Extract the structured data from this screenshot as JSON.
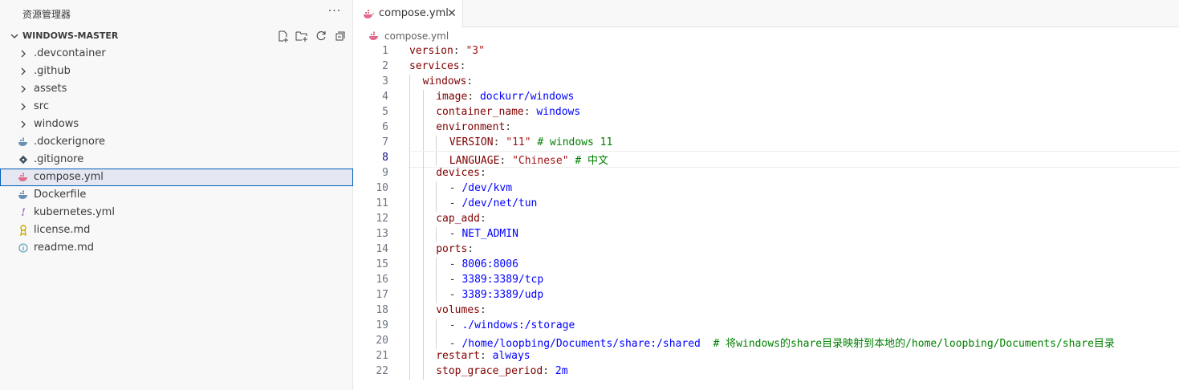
{
  "explorer": {
    "title": "资源管理器",
    "more_label": "···",
    "folder_name": "WINDOWS-MASTER",
    "items": [
      {
        "label": ".devcontainer",
        "kind": "folder",
        "icon": "chevron-right-icon"
      },
      {
        "label": ".github",
        "kind": "folder",
        "icon": "chevron-right-icon"
      },
      {
        "label": "assets",
        "kind": "folder",
        "icon": "chevron-right-icon"
      },
      {
        "label": "src",
        "kind": "folder",
        "icon": "chevron-right-icon"
      },
      {
        "label": "windows",
        "kind": "folder",
        "icon": "chevron-right-icon"
      },
      {
        "label": ".dockerignore",
        "kind": "file",
        "icon": "docker-icon"
      },
      {
        "label": ".gitignore",
        "kind": "file",
        "icon": "git-icon"
      },
      {
        "label": "compose.yml",
        "kind": "file",
        "icon": "docker-compose-icon",
        "selected": true
      },
      {
        "label": "Dockerfile",
        "kind": "file",
        "icon": "docker-icon"
      },
      {
        "label": "kubernetes.yml",
        "kind": "file",
        "icon": "yaml-icon"
      },
      {
        "label": "license.md",
        "kind": "file",
        "icon": "license-icon"
      },
      {
        "label": "readme.md",
        "kind": "file",
        "icon": "info-icon"
      }
    ]
  },
  "editor": {
    "tab_label": "compose.yml",
    "breadcrumb": "compose.yml",
    "current_line": 8,
    "lines": [
      {
        "n": "1",
        "indent": 0,
        "parts": [
          [
            "k",
            "version"
          ],
          [
            "p",
            ": "
          ],
          [
            "s",
            "\"3\""
          ]
        ]
      },
      {
        "n": "2",
        "indent": 0,
        "parts": [
          [
            "k",
            "services"
          ],
          [
            "p",
            ":"
          ]
        ]
      },
      {
        "n": "3",
        "indent": 1,
        "parts": [
          [
            "k",
            "windows"
          ],
          [
            "p",
            ":"
          ]
        ]
      },
      {
        "n": "4",
        "indent": 2,
        "parts": [
          [
            "k",
            "image"
          ],
          [
            "p",
            ": "
          ],
          [
            "v",
            "dockurr/windows"
          ]
        ]
      },
      {
        "n": "5",
        "indent": 2,
        "parts": [
          [
            "k",
            "container_name"
          ],
          [
            "p",
            ": "
          ],
          [
            "v",
            "windows"
          ]
        ]
      },
      {
        "n": "6",
        "indent": 2,
        "parts": [
          [
            "k",
            "environment"
          ],
          [
            "p",
            ":"
          ]
        ]
      },
      {
        "n": "7",
        "indent": 3,
        "parts": [
          [
            "k",
            "VERSION"
          ],
          [
            "p",
            ": "
          ],
          [
            "s",
            "\"11\""
          ],
          [
            "p",
            " "
          ],
          [
            "c",
            "# windows 11"
          ]
        ]
      },
      {
        "n": "8",
        "indent": 3,
        "parts": [
          [
            "k",
            "LANGUAGE"
          ],
          [
            "p",
            ": "
          ],
          [
            "s",
            "\"Chinese\""
          ],
          [
            "p",
            " "
          ],
          [
            "c",
            "# 中文"
          ]
        ]
      },
      {
        "n": "9",
        "indent": 2,
        "parts": [
          [
            "k",
            "devices"
          ],
          [
            "p",
            ":"
          ]
        ]
      },
      {
        "n": "10",
        "indent": 3,
        "parts": [
          [
            "p",
            "- "
          ],
          [
            "v",
            "/dev/kvm"
          ]
        ]
      },
      {
        "n": "11",
        "indent": 3,
        "parts": [
          [
            "p",
            "- "
          ],
          [
            "v",
            "/dev/net/tun"
          ]
        ]
      },
      {
        "n": "12",
        "indent": 2,
        "parts": [
          [
            "k",
            "cap_add"
          ],
          [
            "p",
            ":"
          ]
        ]
      },
      {
        "n": "13",
        "indent": 3,
        "parts": [
          [
            "p",
            "- "
          ],
          [
            "v",
            "NET_ADMIN"
          ]
        ]
      },
      {
        "n": "14",
        "indent": 2,
        "parts": [
          [
            "k",
            "ports"
          ],
          [
            "p",
            ":"
          ]
        ]
      },
      {
        "n": "15",
        "indent": 3,
        "parts": [
          [
            "p",
            "- "
          ],
          [
            "v",
            "8006:8006"
          ]
        ]
      },
      {
        "n": "16",
        "indent": 3,
        "parts": [
          [
            "p",
            "- "
          ],
          [
            "v",
            "3389:3389/tcp"
          ]
        ]
      },
      {
        "n": "17",
        "indent": 3,
        "parts": [
          [
            "p",
            "- "
          ],
          [
            "v",
            "3389:3389/udp"
          ]
        ]
      },
      {
        "n": "18",
        "indent": 2,
        "parts": [
          [
            "k",
            "volumes"
          ],
          [
            "p",
            ":"
          ]
        ]
      },
      {
        "n": "19",
        "indent": 3,
        "parts": [
          [
            "p",
            "- "
          ],
          [
            "v",
            "./windows:/storage"
          ]
        ]
      },
      {
        "n": "20",
        "indent": 3,
        "parts": [
          [
            "p",
            "- "
          ],
          [
            "v",
            "/home/loopbing/Documents/share:/shared"
          ],
          [
            "p",
            "  "
          ],
          [
            "c",
            "# 将windows的share目录映射到本地的/home/loopbing/Documents/share目录"
          ]
        ]
      },
      {
        "n": "21",
        "indent": 2,
        "parts": [
          [
            "k",
            "restart"
          ],
          [
            "p",
            ": "
          ],
          [
            "v",
            "always"
          ]
        ]
      },
      {
        "n": "22",
        "indent": 2,
        "parts": [
          [
            "k",
            "stop_grace_period"
          ],
          [
            "p",
            ": "
          ],
          [
            "v",
            "2m"
          ]
        ]
      }
    ]
  },
  "colors": {
    "key": "#800000",
    "string": "#a31515",
    "value": "#0000ff",
    "comment": "#008000",
    "selection_border": "#005fb8",
    "docker_blue": "#0db7ed",
    "docker_pink": "#e06c8a"
  }
}
